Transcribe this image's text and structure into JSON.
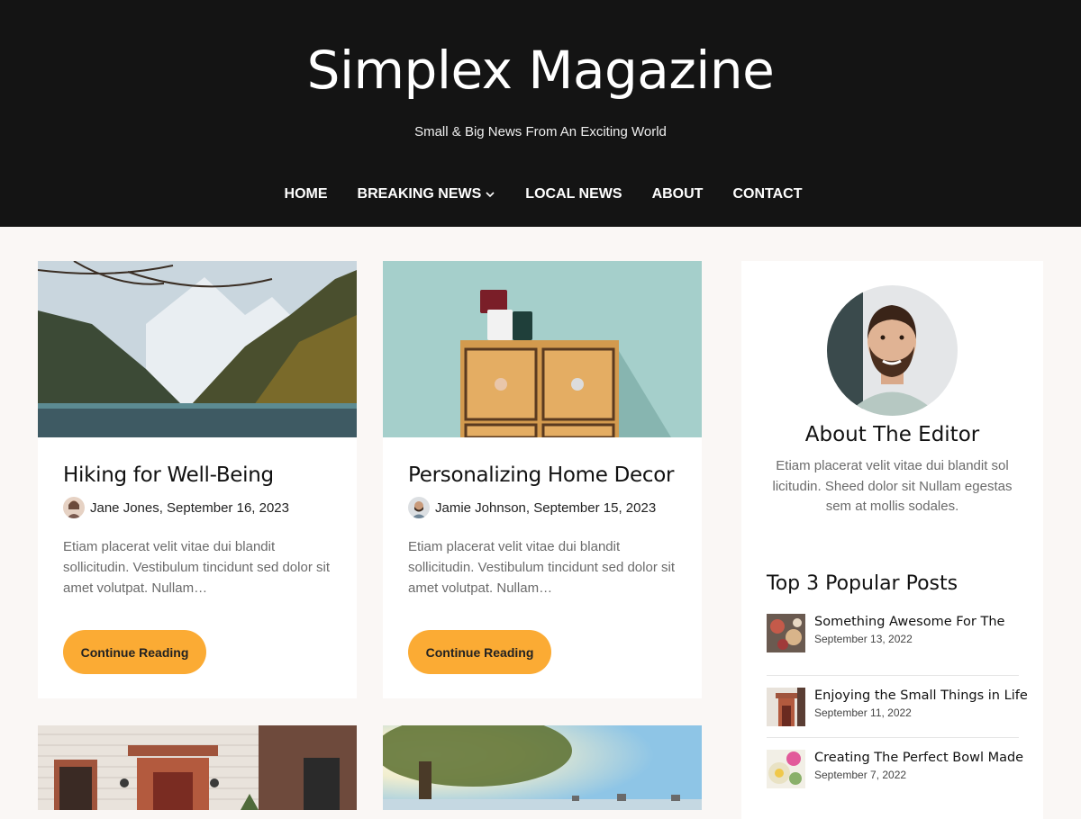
{
  "site": {
    "title": "Simplex Magazine",
    "tagline": "Small & Big News From An Exciting World"
  },
  "nav": {
    "items": [
      {
        "label": "HOME"
      },
      {
        "label": "BREAKING NEWS",
        "icon": "chevron-down-icon"
      },
      {
        "label": "LOCAL NEWS"
      },
      {
        "label": "ABOUT"
      },
      {
        "label": "CONTACT"
      }
    ]
  },
  "posts": [
    {
      "title": "Hiking for Well-Being",
      "author_date": "Jane Jones, September 16, 2023",
      "excerpt": "Etiam placerat velit vitae dui blandit sollicitudin. Vestibulum tincidunt sed dolor sit amet volutpat. Nullam…",
      "button": "Continue Reading",
      "image": "mountain-lake-photo"
    },
    {
      "title": "Personalizing Home Decor",
      "author_date": "Jamie Johnson, September 15, 2023",
      "excerpt": "Etiam placerat velit vitae dui blandit sollicitudin. Vestibulum tincidunt sed dolor sit amet volutpat. Nullam…",
      "button": "Continue Reading",
      "image": "drawer-cabinet-photo"
    },
    {
      "image": "house-facade-photo"
    },
    {
      "image": "sunlit-tree-photo"
    }
  ],
  "sidebar": {
    "about_title": "About The Editor",
    "about_text": "Etiam placerat velit vitae dui blandit sol licitudin. Sheed dolor sit Nullam egestas sem at mollis sodales.",
    "popular_title": "Top 3 Popular Posts",
    "popular": [
      {
        "title": "Something Awesome For The",
        "date": "September 13, 2022"
      },
      {
        "title": "Enjoying the Small Things in Life",
        "date": "September 11, 2022"
      },
      {
        "title": "Creating The Perfect Bowl Made",
        "date": "September 7, 2022"
      }
    ]
  },
  "colors": {
    "header_bg": "#141414",
    "page_bg": "#faf7f5",
    "button_accent": "#fbab34"
  }
}
